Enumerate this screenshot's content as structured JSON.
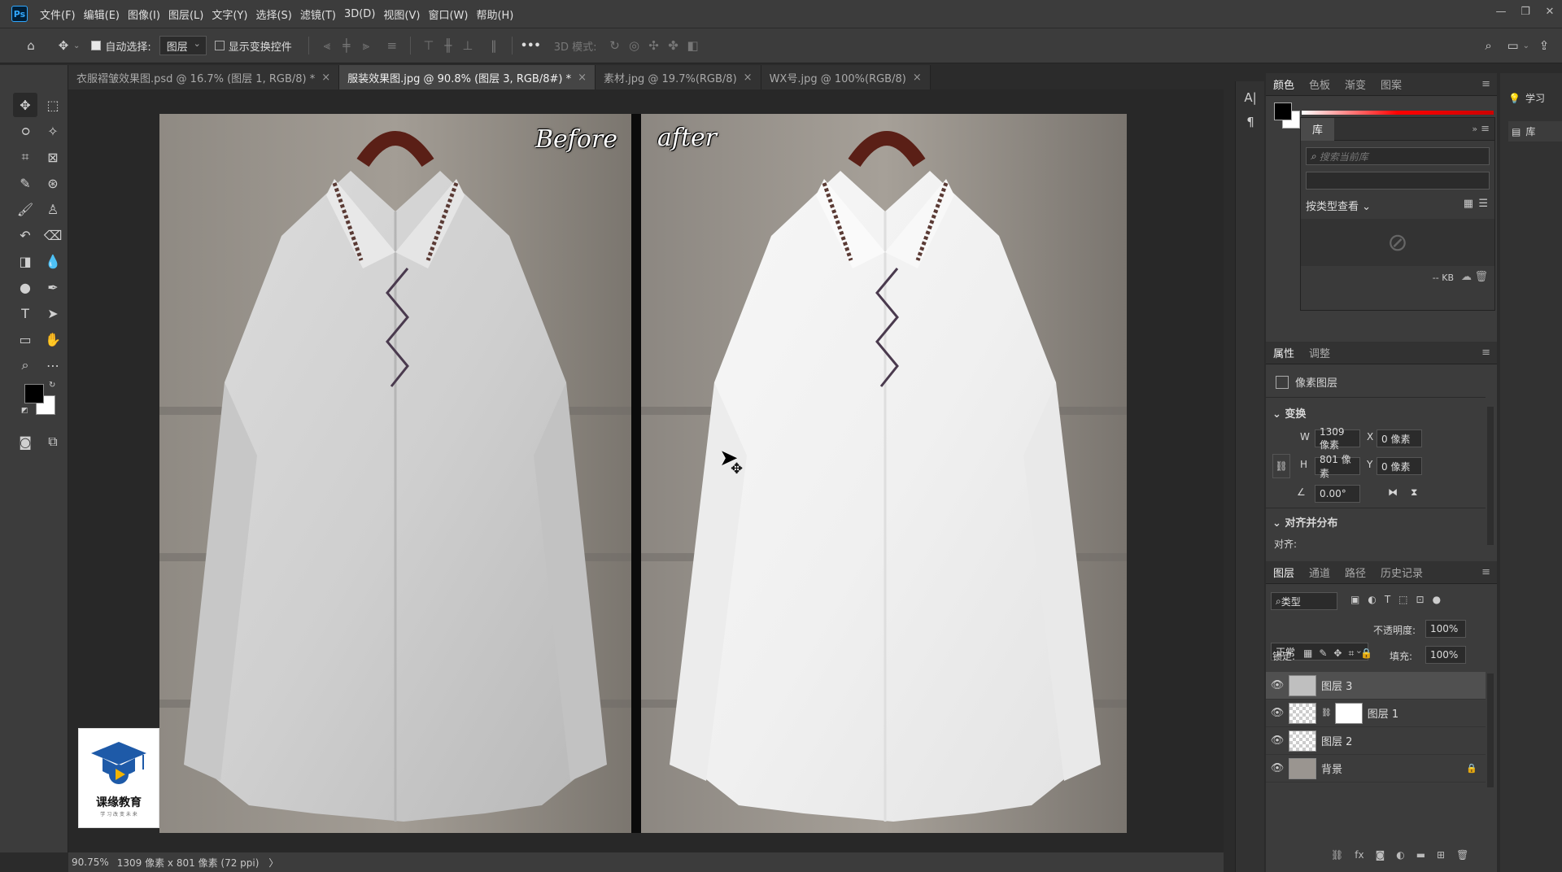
{
  "app": {
    "logo": "Ps"
  },
  "menu": [
    "文件(F)",
    "编辑(E)",
    "图像(I)",
    "图层(L)",
    "文字(Y)",
    "选择(S)",
    "滤镜(T)",
    "3D(D)",
    "视图(V)",
    "窗口(W)",
    "帮助(H)"
  ],
  "window_controls": {
    "minimize": "—",
    "restore": "❐",
    "close": "✕"
  },
  "options": {
    "auto_select_label": "自动选择:",
    "auto_select_target": "图层",
    "show_transform_label": "显示变换控件",
    "more": "•••",
    "mode_3d_label": "3D 模式:"
  },
  "tabs": [
    {
      "label": "衣服褶皱效果图.psd @ 16.7% (图层 1, RGB/8) *",
      "close": "×",
      "active": false
    },
    {
      "label": "服装效果图.jpg @ 90.8% (图层 3, RGB/8#) *",
      "close": "×",
      "active": true
    },
    {
      "label": "素材.jpg @ 19.7%(RGB/8)",
      "close": "×",
      "active": false
    },
    {
      "label": "WX号.jpg @ 100%(RGB/8)",
      "close": "×",
      "active": false
    }
  ],
  "canvas": {
    "before_label": "Before",
    "after_label": "after",
    "logo_text": "课缘教育",
    "logo_sub": "学 习 改 变 未 来"
  },
  "status": {
    "zoom": "90.75%",
    "doc_size": "1309 像素 x 801 像素 (72 ppi)",
    "arrow": "〉"
  },
  "color_panel": {
    "tabs": [
      "颜色",
      "色板",
      "渐变",
      "图案"
    ]
  },
  "library_panel": {
    "tab": "库",
    "search_placeholder": "搜索当前库",
    "view_by": "按类型查看",
    "size": "-- KB"
  },
  "properties_panel": {
    "tabs": [
      "属性",
      "调整"
    ],
    "type": "像素图层",
    "section_transform": "变换",
    "w_label": "W",
    "w_value": "1309 像素",
    "h_label": "H",
    "h_value": "801 像素",
    "x_label": "X",
    "x_value": "0 像素",
    "y_label": "Y",
    "y_value": "0 像素",
    "angle": "0.00°",
    "section_align": "对齐并分布",
    "align_label": "对齐:"
  },
  "layers_panel": {
    "tabs": [
      "图层",
      "通道",
      "路径",
      "历史记录"
    ],
    "filter": "类型",
    "blend_mode": "正常",
    "opacity_label": "不透明度:",
    "opacity_value": "100%",
    "lock_label": "锁定:",
    "fill_label": "填充:",
    "fill_value": "100%",
    "layers": [
      {
        "name": "图层 3",
        "selected": true
      },
      {
        "name": "图层 1",
        "selected": false
      },
      {
        "name": "图层 2",
        "selected": false
      },
      {
        "name": "背景",
        "selected": false
      }
    ]
  },
  "far_right": {
    "learn": "学习",
    "library": "库"
  }
}
